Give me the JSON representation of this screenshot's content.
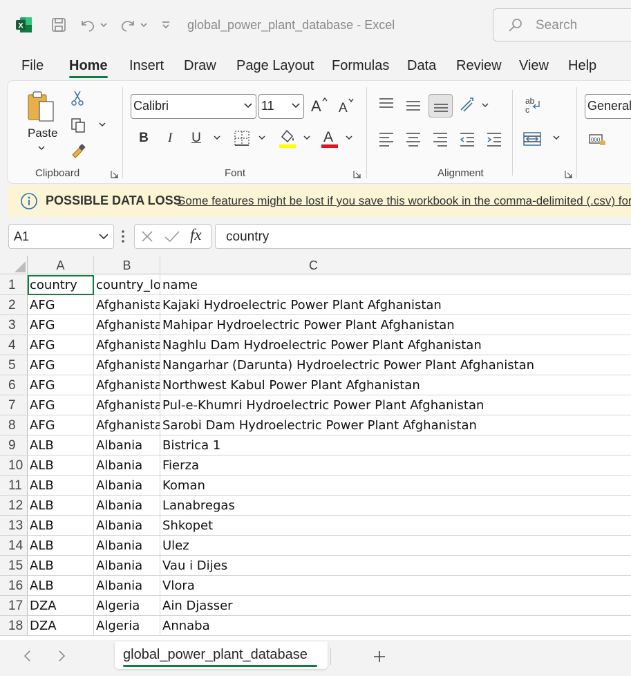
{
  "window": {
    "title": "global_power_plant_database  -  Excel",
    "search_placeholder": "Search"
  },
  "menu_tabs": [
    {
      "label": "File"
    },
    {
      "label": "Home",
      "active": true
    },
    {
      "label": "Insert"
    },
    {
      "label": "Draw"
    },
    {
      "label": "Page Layout"
    },
    {
      "label": "Formulas"
    },
    {
      "label": "Data"
    },
    {
      "label": "Review"
    },
    {
      "label": "View"
    },
    {
      "label": "Help"
    }
  ],
  "ribbon": {
    "clipboard": {
      "label": "Clipboard",
      "paste_label": "Paste"
    },
    "font": {
      "label": "Font",
      "font_name": "Calibri",
      "font_size": "11"
    },
    "alignment": {
      "label": "Alignment"
    },
    "number": {
      "format": "General"
    }
  },
  "info_bar": {
    "title": "POSSIBLE DATA LOSS",
    "message": "Some features might be lost if you save this workbook in the comma-delimited (.csv) format."
  },
  "formula_bar": {
    "name_box": "A1",
    "formula": "country"
  },
  "grid": {
    "columns": [
      "A",
      "B",
      "C"
    ],
    "rows": [
      {
        "num": "1",
        "a": "country",
        "b": "country_long",
        "c": "name"
      },
      {
        "num": "2",
        "a": "AFG",
        "b": "Afghanistan",
        "c": "Kajaki Hydroelectric Power Plant Afghanistan"
      },
      {
        "num": "3",
        "a": "AFG",
        "b": "Afghanistan",
        "c": "Mahipar Hydroelectric Power Plant Afghanistan"
      },
      {
        "num": "4",
        "a": "AFG",
        "b": "Afghanistan",
        "c": "Naghlu Dam Hydroelectric Power Plant Afghanistan"
      },
      {
        "num": "5",
        "a": "AFG",
        "b": "Afghanistan",
        "c": "Nangarhar (Darunta) Hydroelectric Power Plant Afghanistan"
      },
      {
        "num": "6",
        "a": "AFG",
        "b": "Afghanistan",
        "c": "Northwest Kabul Power Plant Afghanistan"
      },
      {
        "num": "7",
        "a": "AFG",
        "b": "Afghanistan",
        "c": "Pul-e-Khumri Hydroelectric Power Plant Afghanistan"
      },
      {
        "num": "8",
        "a": "AFG",
        "b": "Afghanistan",
        "c": "Sarobi Dam Hydroelectric Power Plant Afghanistan"
      },
      {
        "num": "9",
        "a": "ALB",
        "b": "Albania",
        "c": "Bistrica 1"
      },
      {
        "num": "10",
        "a": "ALB",
        "b": "Albania",
        "c": "Fierza"
      },
      {
        "num": "11",
        "a": "ALB",
        "b": "Albania",
        "c": "Koman"
      },
      {
        "num": "12",
        "a": "ALB",
        "b": "Albania",
        "c": "Lanabregas"
      },
      {
        "num": "13",
        "a": "ALB",
        "b": "Albania",
        "c": "Shkopet"
      },
      {
        "num": "14",
        "a": "ALB",
        "b": "Albania",
        "c": "Ulez"
      },
      {
        "num": "15",
        "a": "ALB",
        "b": "Albania",
        "c": "Vau i Dijes"
      },
      {
        "num": "16",
        "a": "ALB",
        "b": "Albania",
        "c": "Vlora"
      },
      {
        "num": "17",
        "a": "DZA",
        "b": "Algeria",
        "c": "Ain Djasser"
      },
      {
        "num": "18",
        "a": "DZA",
        "b": "Algeria",
        "c": "Annaba"
      }
    ]
  },
  "sheets": [
    {
      "name": "global_power_plant_database",
      "active": true
    }
  ],
  "colors": {
    "accent": "#107c41",
    "info_bar": "#fbf5d6"
  }
}
